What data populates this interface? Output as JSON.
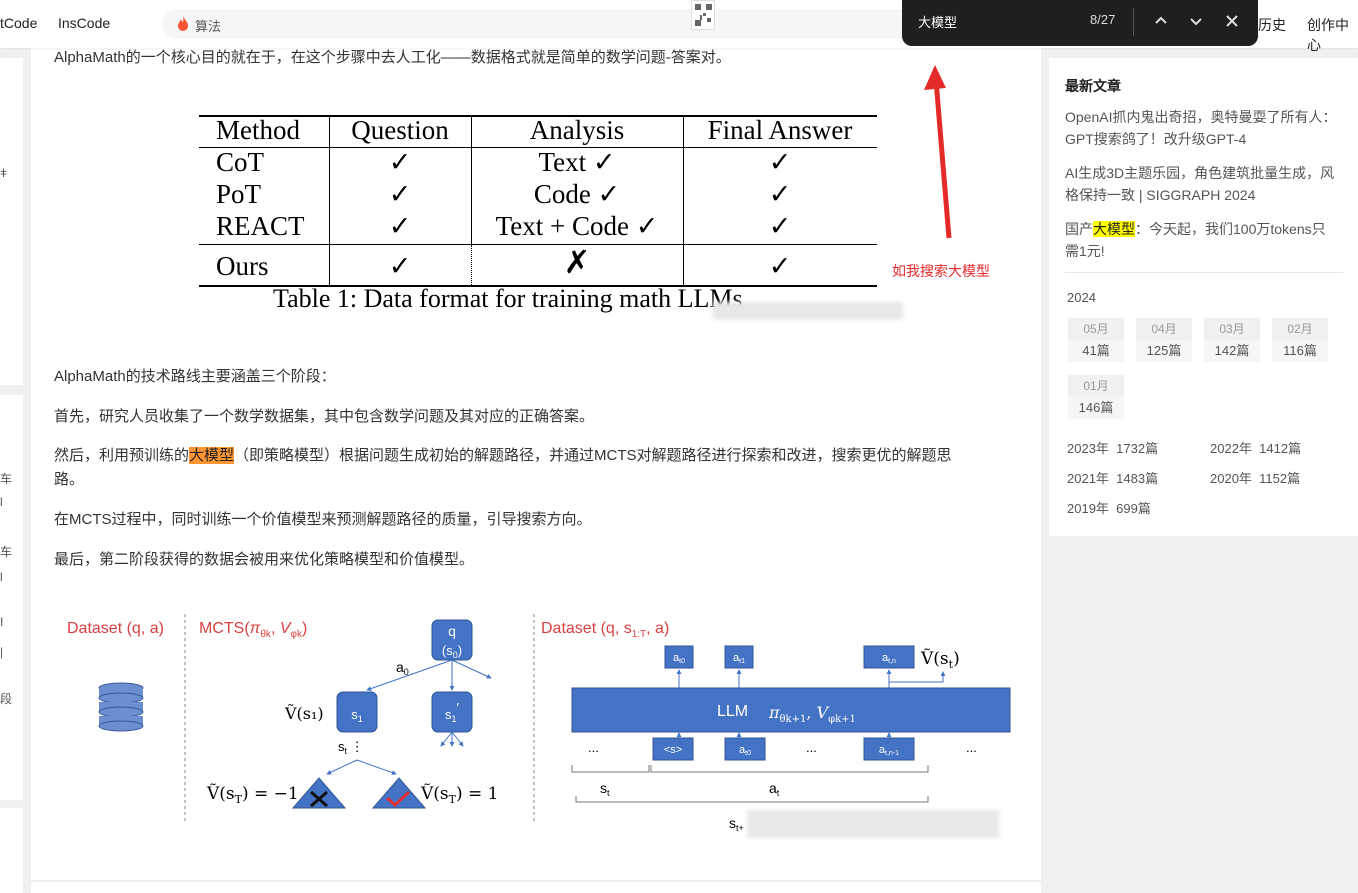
{
  "topbar": {
    "nav_left_partial": "tCode",
    "nav_inscode": "InsCode",
    "search_text": "算法",
    "nav_history": "历史",
    "nav_creator": "创作中心"
  },
  "findbar": {
    "query": "大模型",
    "count": "8/27"
  },
  "left_sidebar": {
    "chars": [
      "ǂ",
      "车",
      "l",
      "车",
      "l",
      "I",
      "|",
      "段"
    ]
  },
  "article": {
    "intro": "AlphaMath的一个核心目的就在于，在这个步骤中去人工化——数据格式就是简单的数学问题-答案对。",
    "table": {
      "headers": [
        "Method",
        "Question",
        "Analysis",
        "Final Answer"
      ],
      "rows": [
        [
          "CoT",
          "✓",
          "Text ✓",
          "✓"
        ],
        [
          "PoT",
          "✓",
          "Code ✓",
          "✓"
        ],
        [
          "REACT",
          "✓",
          "Text + Code ✓",
          "✓"
        ],
        [
          "Ours",
          "✓",
          "✗",
          "✓"
        ]
      ],
      "caption": "Table 1: Data format for training math LLMs"
    },
    "stages_intro": "AlphaMath的技术路线主要涵盖三个阶段：",
    "step1": "首先，研究人员收集了一个数学数据集，其中包含数学问题及其对应的正确答案。",
    "step2_before": "然后，利用预训练的",
    "step2_highlight": "大模型",
    "step2_after": "（即策略模型）根据问题生成初始的解题路径，并通过MCTS对解题路径进行探索和改进，搜索更优的解题思",
    "step2_wrap": "路。",
    "step3": "在MCTS过程中，同时训练一个价值模型来预测解题路径的质量，引导搜索方向。",
    "step4": "最后，第二阶段获得的数据会被用来优化策略模型和价值模型。"
  },
  "diagram": {
    "dataset_label": "Dataset (q, a)",
    "mcts_label": "MCTS(",
    "dataset2_label": "Dataset (q, s",
    "root_q": "q",
    "root_s0": "(s",
    "a0": "a",
    "s1": "s",
    "st": "s",
    "v_s1": "Ṽ(s₁)",
    "v_neg": "Ṽ(s",
    "v_neg_val": ") = −1",
    "v_pos_val": ") = 1",
    "llm": "LLM",
    "v_st": "Ṽ(s",
    "dots": "...",
    "token_s": "<s>",
    "brace_st": "s",
    "brace_at": "a",
    "brace_st1": "s"
  },
  "annotation": "如我搜索大模型",
  "right_sidebar": {
    "title": "最新文章",
    "articles": [
      "OpenAI抓内鬼出奇招，奥特曼耍了所有人：GPT搜索鸽了！改升级GPT-4",
      "AI生成3D主题乐园，角色建筑批量生成，风格保持一致 | SIGGRAPH 2024"
    ],
    "article3_before": "国产",
    "article3_highlight": "大模型",
    "article3_after": "：今天起，我们100万tokens只需1元!",
    "year": "2024",
    "months": [
      {
        "label": "05月",
        "count": "41篇"
      },
      {
        "label": "04月",
        "count": "125篇"
      },
      {
        "label": "03月",
        "count": "142篇"
      },
      {
        "label": "02月",
        "count": "116篇"
      },
      {
        "label": "01月",
        "count": "146篇"
      }
    ],
    "years": [
      {
        "year": "2023年",
        "count": "1732篇"
      },
      {
        "year": "2022年",
        "count": "1412篇"
      },
      {
        "year": "2021年",
        "count": "1483篇"
      },
      {
        "year": "2020年",
        "count": "1152篇"
      },
      {
        "year": "2019年",
        "count": "699篇"
      }
    ]
  },
  "colors": {
    "accent_red": "#e52a2a",
    "find_highlight": "#ff9632",
    "match_highlight": "#ffff00",
    "diagram_blue": "#4472c4"
  }
}
